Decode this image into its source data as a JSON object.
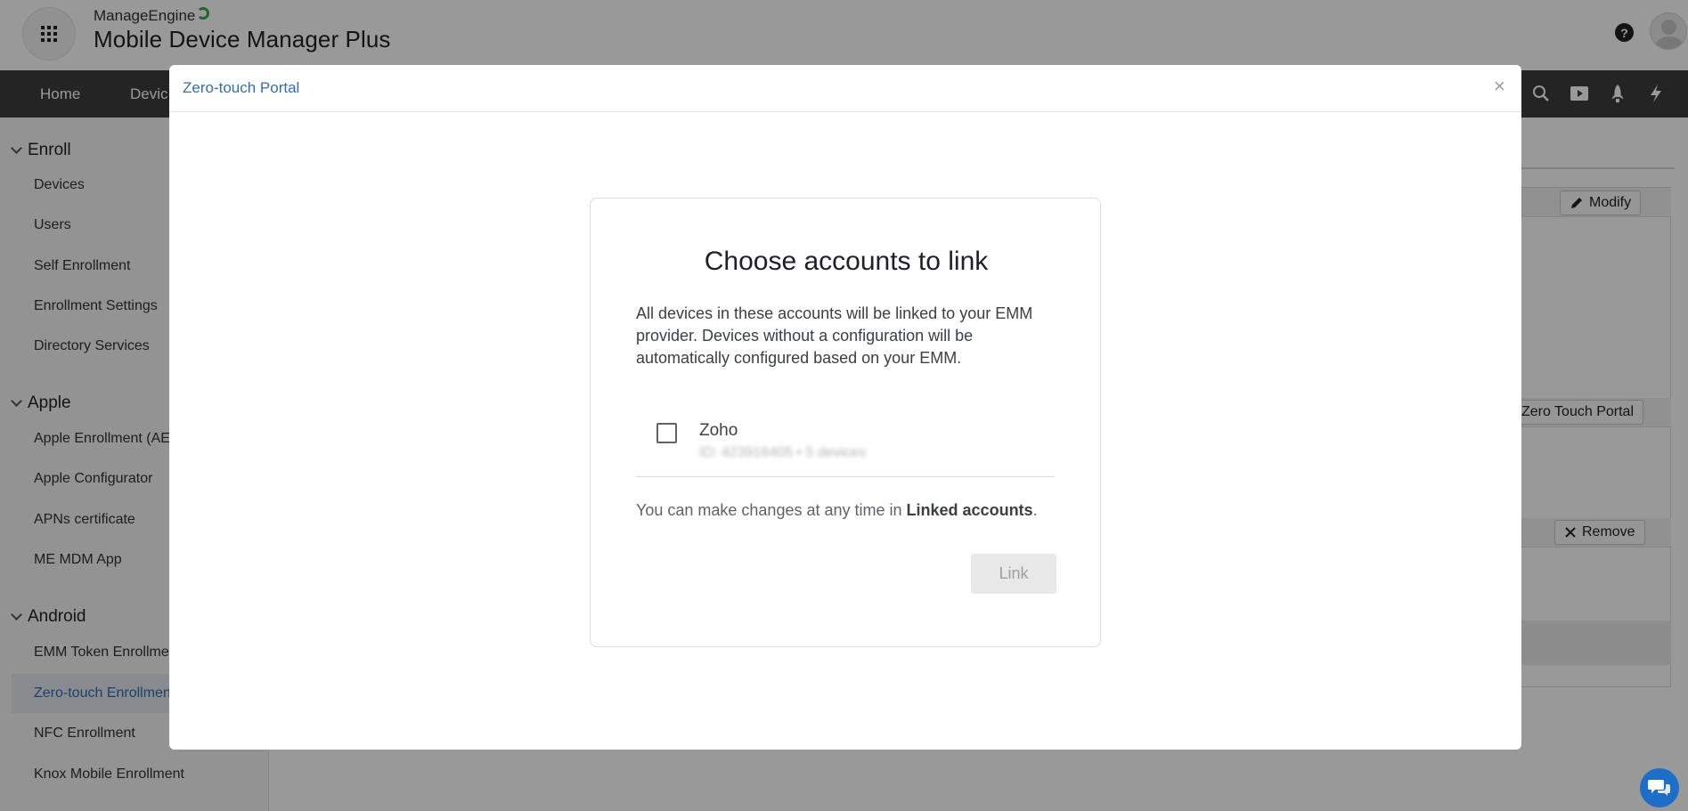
{
  "header": {
    "apps_icon": "grid-icon",
    "brand_vendor": "ManageEngine",
    "brand_product": "Mobile Device Manager Plus",
    "help_icon_glyph": "?"
  },
  "navbar": {
    "items": [
      "Home",
      "Devic"
    ],
    "right_icons": [
      "search-icon",
      "video-icon",
      "rocket-icon",
      "bolt-icon"
    ]
  },
  "sidebar": {
    "sections": [
      {
        "title": "Enroll",
        "items": [
          "Devices",
          "Users",
          "Self Enrollment",
          "Enrollment Settings",
          "Directory Services"
        ]
      },
      {
        "title": "Apple",
        "items": [
          "Apple Enrollment (AE",
          "Apple Configurator",
          "APNs certificate",
          "ME MDM App"
        ]
      },
      {
        "title": "Android",
        "items": [
          "EMM Token Enrollme",
          "Zero-touch Enrollmen",
          "NFC Enrollment",
          "Knox Mobile Enrollment"
        ]
      }
    ],
    "active_item": "Zero-touch Enrollmen"
  },
  "background_main": {
    "modify_label": "Modify",
    "zero_touch_portal_label": "Zero Touch Portal",
    "remove_label": "Remove"
  },
  "modal": {
    "title": "Zero-touch Portal",
    "close_glyph": "×",
    "card": {
      "title": "Choose accounts to link",
      "description": "All devices in these accounts will be linked to your EMM provider. Devices without a configuration will be automatically configured based on your EMM.",
      "account": {
        "name": "Zoho",
        "meta": "ID: 423916405 • 5 devices",
        "checked": false
      },
      "note_prefix": "You can make changes at any time in ",
      "note_link": "Linked accounts",
      "note_suffix": ".",
      "link_button": "Link"
    }
  },
  "colors": {
    "accent_blue": "#2f6fb4",
    "navbar_bg": "#3d3d3d",
    "chat_blue": "#1c6ec8"
  }
}
